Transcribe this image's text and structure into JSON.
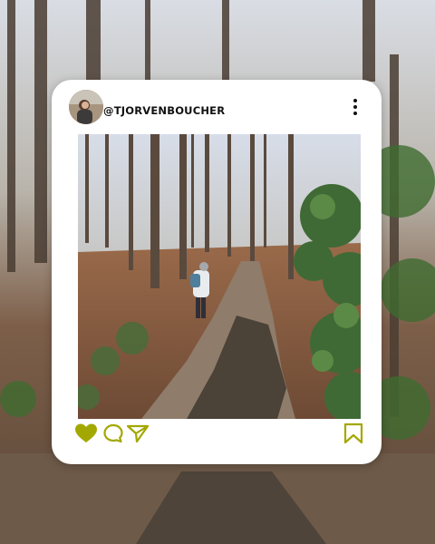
{
  "post": {
    "username": "@TJORVENBOUCHER"
  },
  "icons": {
    "avatar": "profile-photo",
    "more": "more-vertical-icon",
    "like": "heart-icon",
    "comment": "comment-bubble-icon",
    "share": "send-paper-plane-icon",
    "save": "bookmark-icon"
  },
  "colors": {
    "accent": "#a3a800",
    "card": "#ffffff"
  },
  "state": {
    "liked": true
  }
}
